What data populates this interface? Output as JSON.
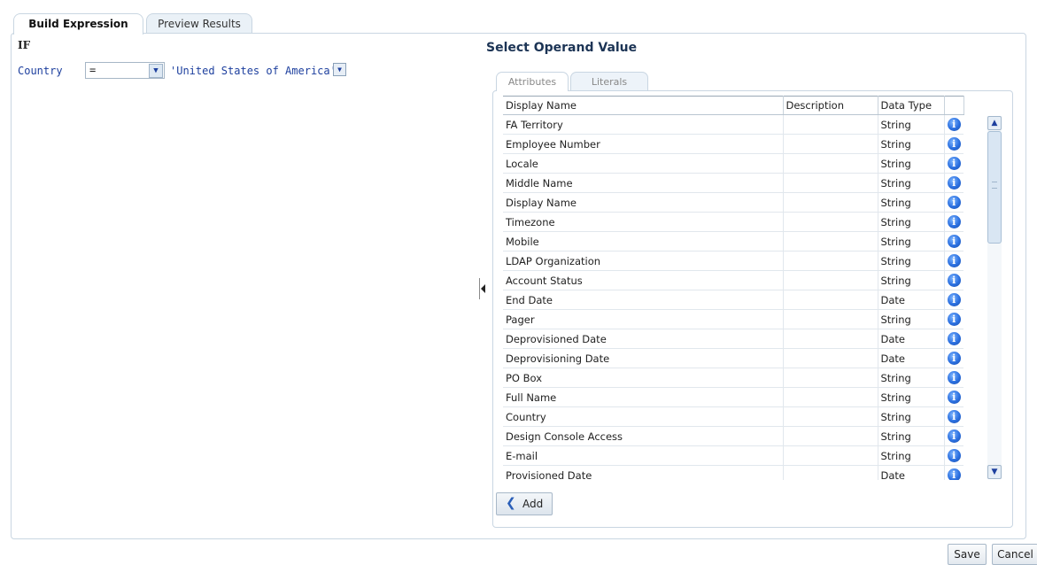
{
  "tabs": [
    {
      "label": "Build Expression",
      "active": true
    },
    {
      "label": "Preview Results",
      "active": false
    }
  ],
  "expression": {
    "if_label": "IF",
    "operand": "Country",
    "operator": "=",
    "literal": "'United States of America'"
  },
  "operand_panel": {
    "title": "Select Operand Value",
    "subtabs": [
      "Attributes",
      "Literals"
    ],
    "columns": [
      "Display Name",
      "Description",
      "Data Type",
      ""
    ],
    "rows": [
      {
        "name": "FA Territory",
        "description": "",
        "type": "String"
      },
      {
        "name": "Employee Number",
        "description": "",
        "type": "String"
      },
      {
        "name": "Locale",
        "description": "",
        "type": "String"
      },
      {
        "name": "Middle Name",
        "description": "",
        "type": "String"
      },
      {
        "name": "Display Name",
        "description": "",
        "type": "String"
      },
      {
        "name": "Timezone",
        "description": "",
        "type": "String"
      },
      {
        "name": "Mobile",
        "description": "",
        "type": "String"
      },
      {
        "name": "LDAP Organization",
        "description": "",
        "type": "String"
      },
      {
        "name": "Account Status",
        "description": "",
        "type": "String"
      },
      {
        "name": "End Date",
        "description": "",
        "type": "Date"
      },
      {
        "name": "Pager",
        "description": "",
        "type": "String"
      },
      {
        "name": "Deprovisioned Date",
        "description": "",
        "type": "Date"
      },
      {
        "name": "Deprovisioning Date",
        "description": "",
        "type": "Date"
      },
      {
        "name": "PO Box",
        "description": "",
        "type": "String"
      },
      {
        "name": "Full Name",
        "description": "",
        "type": "String"
      },
      {
        "name": "Country",
        "description": "",
        "type": "String"
      },
      {
        "name": "Design Console Access",
        "description": "",
        "type": "String"
      },
      {
        "name": "E-mail",
        "description": "",
        "type": "String"
      },
      {
        "name": "Provisioned Date",
        "description": "",
        "type": "Date"
      }
    ],
    "add_label": "Add"
  },
  "footer": {
    "save_label": "Save",
    "cancel_label": "Cancel"
  },
  "icons": {
    "info": "info-icon",
    "add": "double-chevron-left-icon",
    "dropdown": "chevron-down-icon"
  },
  "colors": {
    "title": "#1c3455",
    "expression_text": "#1d3f9e",
    "info_icon": "#2a6fe0"
  }
}
